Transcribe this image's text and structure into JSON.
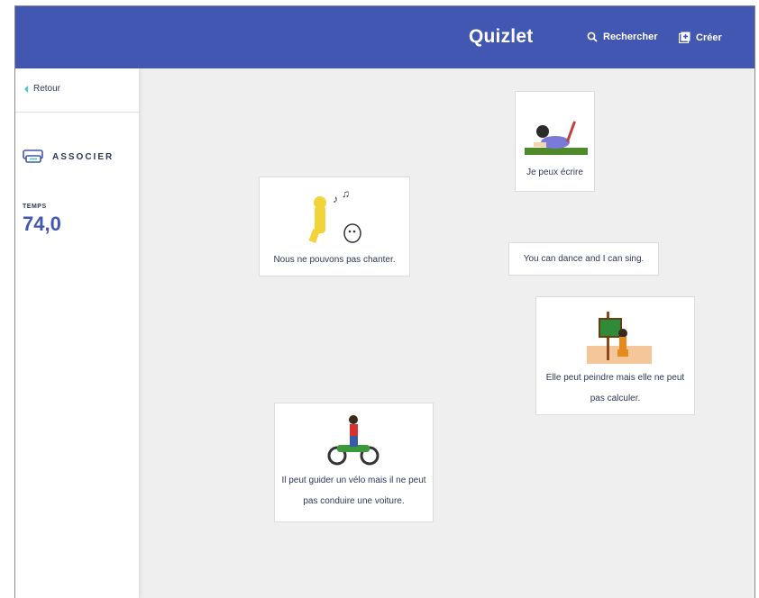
{
  "header": {
    "logo": "Quizlet",
    "search_label": "Rechercher",
    "create_label": "Créer"
  },
  "sidebar": {
    "back_label": "Retour",
    "mode_label": "ASSOCIER",
    "time_label": "TEMPS",
    "time_value": "74,0"
  },
  "cards": {
    "c1": "Je peux écrire",
    "c2": "Nous ne pouvons pas chanter.",
    "c3": "You can dance and I can sing.",
    "c4": "Elle peut peindre mais elle ne peut pas calculer.",
    "c5": "Il peut guider un vélo mais il ne peut pas conduire une voiture."
  },
  "colors": {
    "header": "#4257b2",
    "accent": "#3ccfcf",
    "text": "#2e3856"
  },
  "icons": [
    "search-icon",
    "create-icon",
    "back-arrow-icon",
    "match-mode-icon"
  ]
}
